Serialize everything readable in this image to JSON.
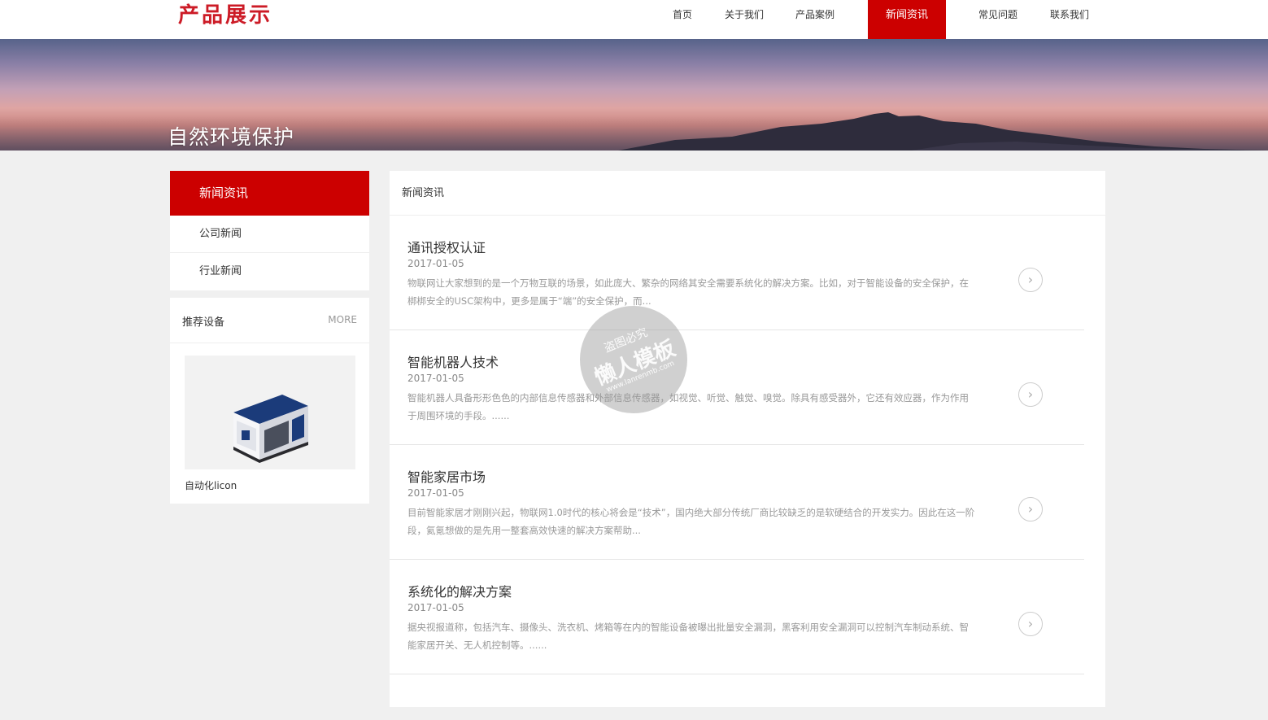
{
  "brand": {
    "logo_text": "产品展示",
    "accent": "#cc0000"
  },
  "nav": {
    "items": [
      {
        "label": "首页",
        "active": false
      },
      {
        "label": "关于我们",
        "active": false
      },
      {
        "label": "产品案例",
        "active": false
      },
      {
        "label": "新闻资讯",
        "active": true
      },
      {
        "label": "常见问题",
        "active": false
      },
      {
        "label": "联系我们",
        "active": false
      }
    ]
  },
  "banner": {
    "title": "自然环境保护"
  },
  "sidebar": {
    "header": "新闻资讯",
    "items": [
      {
        "label": "公司新闻"
      },
      {
        "label": "行业新闻"
      }
    ]
  },
  "recommend": {
    "title": "推荐设备",
    "more": "MORE",
    "product_name": "自动化licon"
  },
  "main": {
    "heading": "新闻资讯",
    "news": [
      {
        "title": "通讯授权认证",
        "date": "2017-01-05",
        "desc": "物联网让大家想到的是一个万物互联的场景，如此庞大、繁杂的网络其安全需要系统化的解决方案。比如，对于智能设备的安全保护，在梆梆安全的USC架构中，更多是属于“端”的安全保护，而..."
      },
      {
        "title": "智能机器人技术",
        "date": "2017-01-05",
        "desc": "智能机器人具备形形色色的内部信息传感器和外部信息传感器，如视觉、听觉、触觉、嗅觉。除具有感受器外，它还有效应器，作为作用于周围环境的手段。......"
      },
      {
        "title": "智能家居市场",
        "date": "2017-01-05",
        "desc": "目前智能家居才刚刚兴起，物联网1.0时代的核心将会是“技术”，国内绝大部分传统厂商比较缺乏的是软硬结合的开发实力。因此在这一阶段，氦氪想做的是先用一整套高效快速的解决方案帮助..."
      },
      {
        "title": "系统化的解决方案",
        "date": "2017-01-05",
        "desc": "据央视报道称，包括汽车、摄像头、洗衣机、烤箱等在内的智能设备被曝出批量安全漏洞，黑客利用安全漏洞可以控制汽车制动系统、智能家居开关、无人机控制等。......"
      }
    ],
    "arrow_icon": "chevron-right-circle-icon"
  },
  "watermark": {
    "line1": "盗图必究",
    "line2": "懒人模板",
    "line3": "www.lanrenmb.com"
  }
}
